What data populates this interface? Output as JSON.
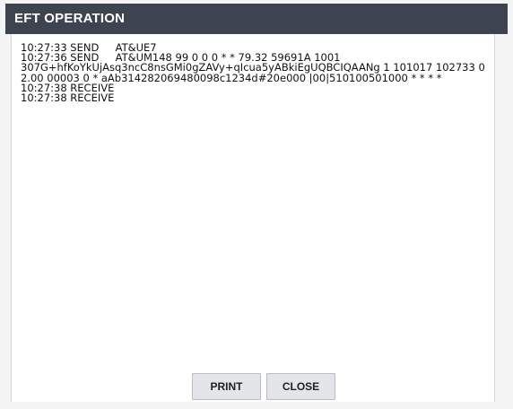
{
  "dialog": {
    "title": "EFT OPERATION"
  },
  "log": {
    "lines": [
      "10:27:33 SEND     AT&UE7",
      "10:27:36 SEND     AT&UM148 99 0 0 0 * * 79.32 59691A 1001",
      "307G+hfKoYkUjAsq3ncC8nsGMi0gZAVy+qIcua5yABkiEgUQBCIQAANg 1 101017 102733 0",
      "2.00 00003 0 * aAb314282069480098c1234d#20e000 |00|510100501000 * * * *",
      "10:27:38 RECEIVE",
      "10:27:38 RECEIVE"
    ]
  },
  "buttons": {
    "print_label": "PRINT",
    "close_label": "CLOSE"
  }
}
